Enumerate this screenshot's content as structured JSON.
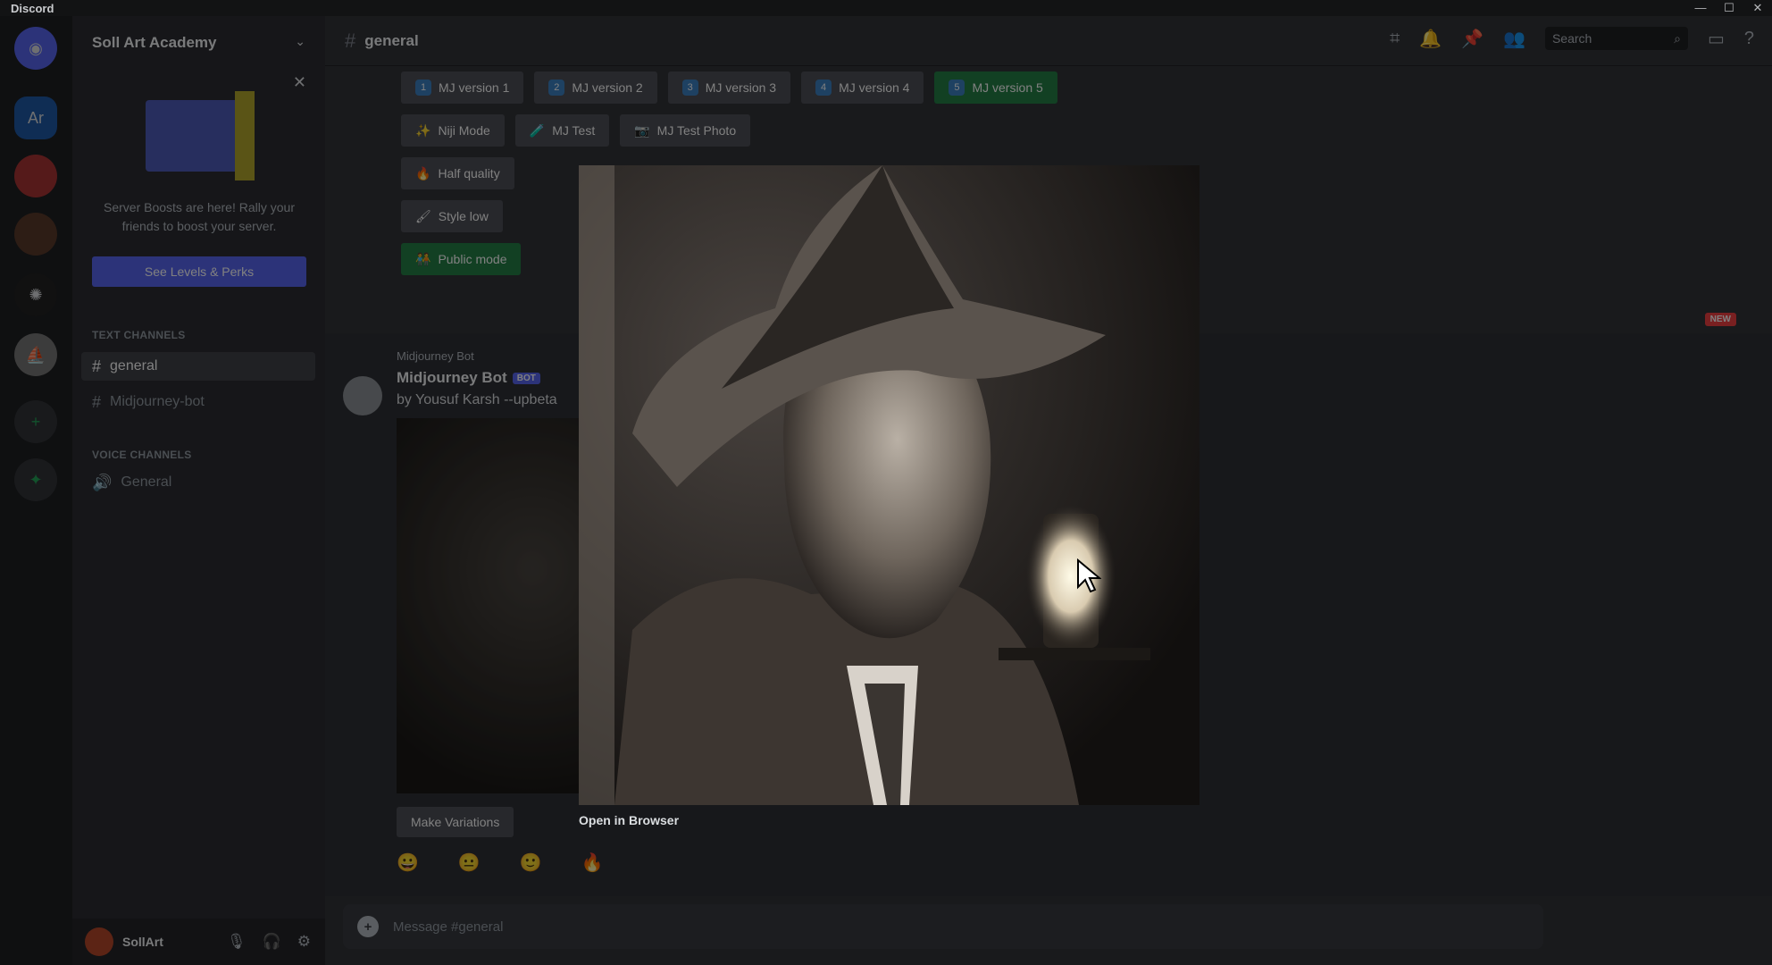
{
  "window": {
    "brand": "Discord",
    "controls": {
      "minimize": "—",
      "maximize": "☐",
      "close": "✕"
    }
  },
  "rail": {
    "servers": [
      {
        "name": "home",
        "label": "",
        "icon": "discord-icon"
      },
      {
        "name": "art-academy",
        "label": "Ar",
        "icon": ""
      },
      {
        "name": "server-3",
        "label": "",
        "icon": "server-icon"
      },
      {
        "name": "server-4",
        "label": "",
        "icon": "server-icon"
      },
      {
        "name": "openai",
        "label": "",
        "icon": "openai-icon"
      },
      {
        "name": "midjourney",
        "label": "",
        "icon": "midjourney-icon"
      },
      {
        "name": "add-server",
        "label": "+",
        "icon": "plus-icon"
      },
      {
        "name": "explore",
        "label": "✦",
        "icon": "compass-icon"
      }
    ]
  },
  "sidebar": {
    "server_name": "Soll Art Academy",
    "boost": {
      "text": "Server Boosts are here! Rally your friends to boost your server.",
      "button": "See Levels & Perks"
    },
    "categories": [
      {
        "label": "Text Channels",
        "channels": [
          {
            "name": "general",
            "active": true
          },
          {
            "name": "Midjourney-bot",
            "active": false
          }
        ]
      },
      {
        "label": "Voice Channels",
        "channels": [
          {
            "name": "General",
            "active": false
          }
        ]
      }
    ],
    "user": {
      "name": "SollArt"
    }
  },
  "header": {
    "channel": "general",
    "search_placeholder": "Search"
  },
  "buttons": {
    "row1": [
      {
        "num": "1",
        "label": "MJ version 1"
      },
      {
        "num": "2",
        "label": "MJ version 2"
      },
      {
        "num": "3",
        "label": "MJ version 3"
      },
      {
        "num": "4",
        "label": "MJ version 4"
      },
      {
        "num": "5",
        "label": "MJ version 5",
        "active": true
      }
    ],
    "row2": [
      {
        "label": "Niji Mode"
      },
      {
        "label": "MJ Test"
      },
      {
        "label": "MJ Test Photo"
      }
    ],
    "row3": [
      {
        "label": "Half quality"
      }
    ],
    "row4": [
      {
        "label": "Style low"
      }
    ],
    "row5": [
      {
        "label": "Public mode",
        "active": true
      }
    ]
  },
  "message": {
    "reply_line": "Midjourney Bot",
    "author": "Midjourney Bot",
    "bot_tag": "BOT",
    "body": "by Yousuf Karsh --upbeta",
    "vary_button": "Make Variations",
    "reactions": [
      "😀",
      "😐",
      "🙂",
      "🔥"
    ],
    "new_badge": "NEW"
  },
  "input": {
    "placeholder": "Message #general"
  },
  "viewer": {
    "open_link": "Open in Browser"
  },
  "colors": {
    "accent": "#5865f2",
    "green": "#248046",
    "bg": "#313338"
  }
}
